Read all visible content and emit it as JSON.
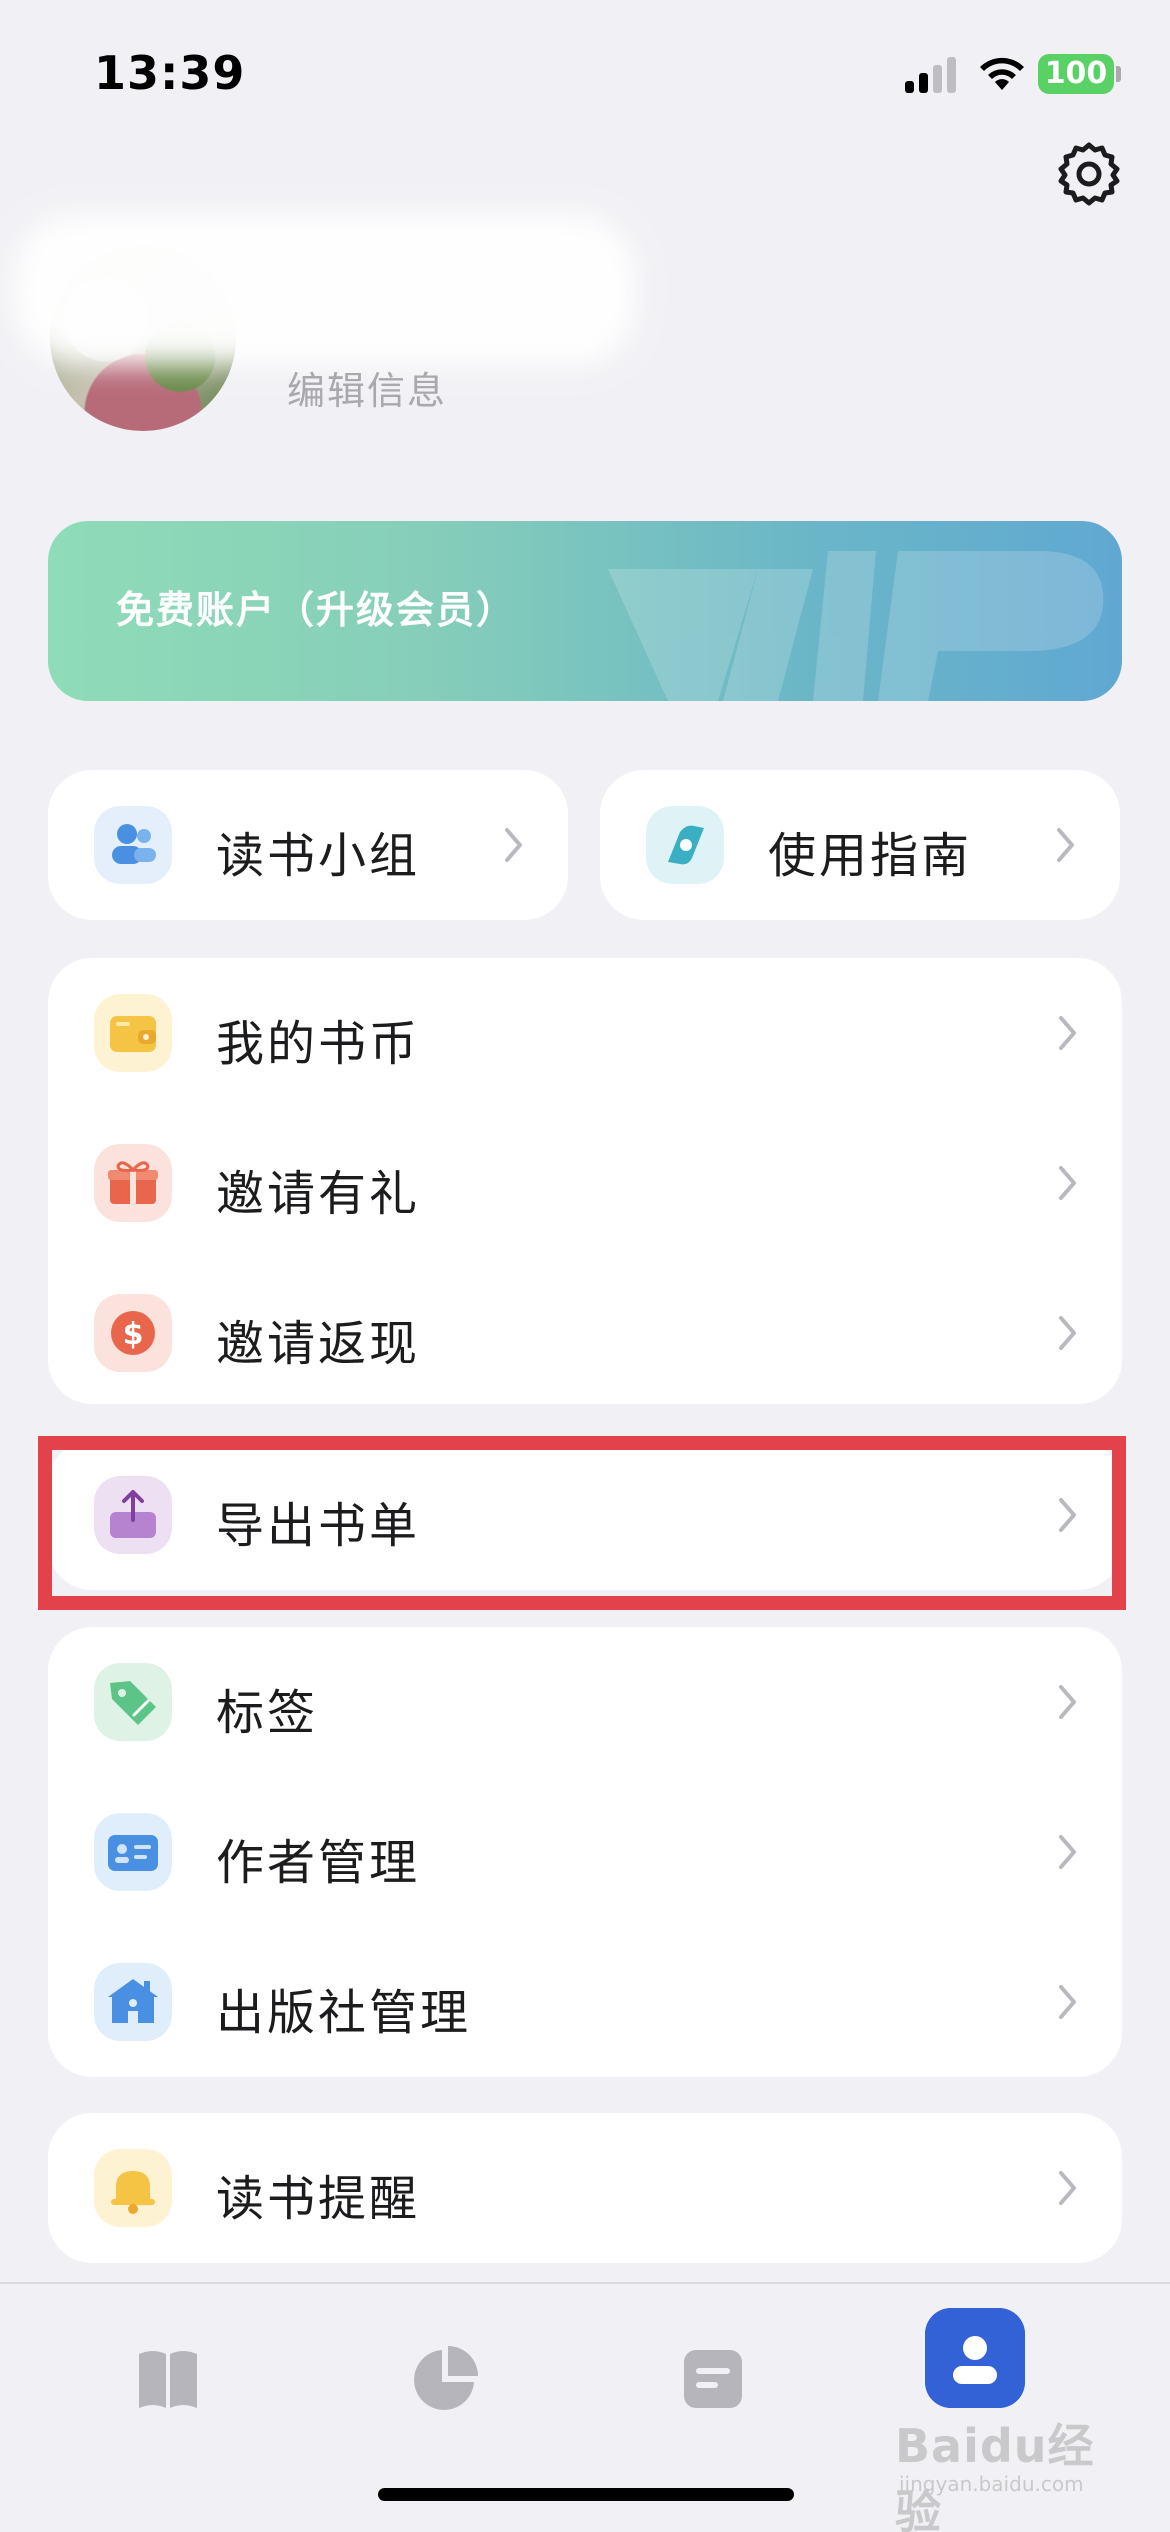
{
  "status_bar": {
    "time": "13:39",
    "battery": "100",
    "icons": [
      "cellular-signal-icon",
      "wifi-icon",
      "battery-icon"
    ]
  },
  "header": {
    "settings_icon": "gear-icon"
  },
  "profile": {
    "edit_info": "编辑信息"
  },
  "vip_banner": {
    "text": "免费账户（升级会员）",
    "watermark_text": "VIP"
  },
  "quick_links": [
    {
      "label": "读书小组",
      "icon": "reading-group-icon",
      "color": "#4a90e2"
    },
    {
      "label": "使用指南",
      "icon": "compass-icon",
      "color": "#3aaec2"
    }
  ],
  "menu_group_1": [
    {
      "label": "我的书币",
      "icon": "wallet-icon",
      "color": "#f5c444"
    },
    {
      "label": "邀请有礼",
      "icon": "gift-icon",
      "color": "#e8664b"
    },
    {
      "label": "邀请返现",
      "icon": "dollar-icon",
      "color": "#e8664b"
    }
  ],
  "menu_export": {
    "label": "导出书单",
    "icon": "export-icon",
    "color": "#9b59b6"
  },
  "menu_group_2": [
    {
      "label": "标签",
      "icon": "tag-icon",
      "color": "#5cc486"
    },
    {
      "label": "作者管理",
      "icon": "id-card-icon",
      "color": "#4a90e2"
    },
    {
      "label": "出版社管理",
      "icon": "building-icon",
      "color": "#4a90e2"
    }
  ],
  "menu_remind": {
    "label": "读书提醒",
    "icon": "bell-icon",
    "color": "#f5c444"
  },
  "tab_bar": {
    "tabs": [
      {
        "icon": "book-icon",
        "active": false
      },
      {
        "icon": "pie-chart-icon",
        "active": false
      },
      {
        "icon": "note-icon",
        "active": false
      },
      {
        "icon": "profile-icon",
        "active": true
      }
    ],
    "accent": "#3362d6"
  },
  "watermark": {
    "main": "Baidu经验",
    "sub": "jingyan.baidu.com"
  }
}
